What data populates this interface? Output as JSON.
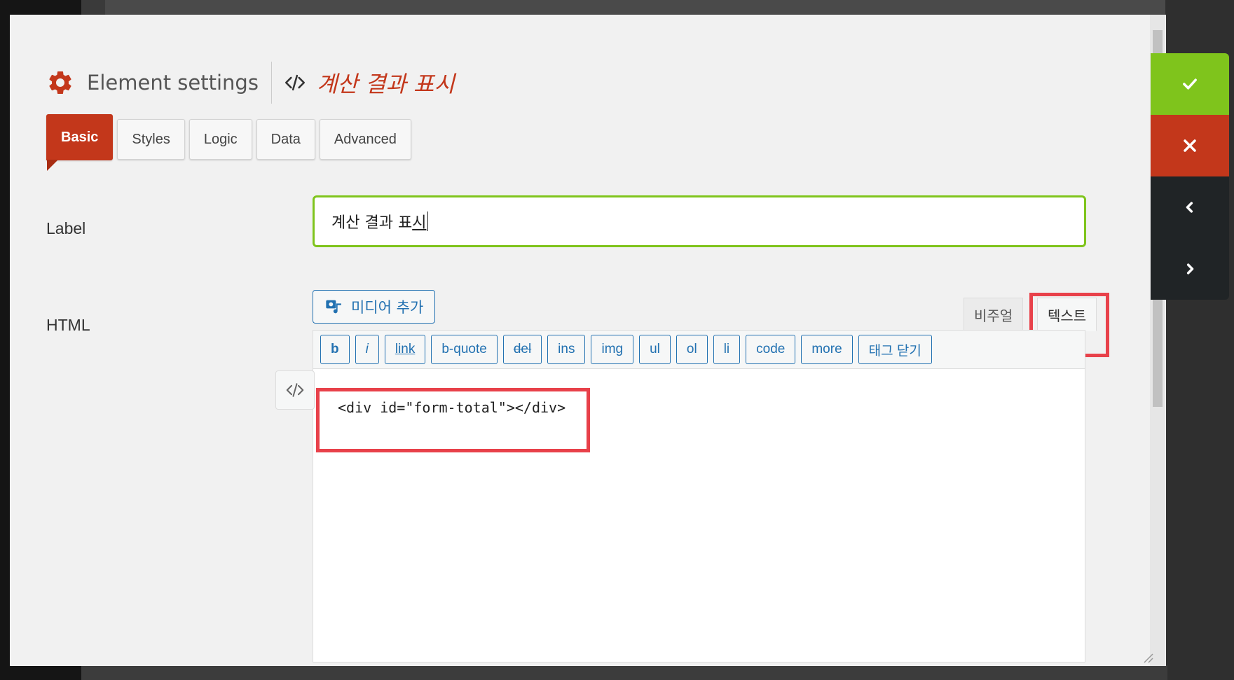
{
  "header": {
    "title": "Element settings",
    "element_name": "계산 결과 표시"
  },
  "tabs": [
    {
      "label": "Basic",
      "active": true
    },
    {
      "label": "Styles",
      "active": false
    },
    {
      "label": "Logic",
      "active": false
    },
    {
      "label": "Data",
      "active": false
    },
    {
      "label": "Advanced",
      "active": false
    }
  ],
  "fields": {
    "label_caption": "Label",
    "label_value_prefix": "계산 결과 표",
    "label_value_composing": "시",
    "html_caption": "HTML"
  },
  "editor": {
    "add_media_label": "미디어 추가",
    "mode_visual": "비주얼",
    "mode_text": "텍스트",
    "active_mode": "텍스트",
    "quicktags": [
      "b",
      "i",
      "link",
      "b-quote",
      "del",
      "ins",
      "img",
      "ul",
      "ol",
      "li",
      "code",
      "more",
      "태그 닫기"
    ],
    "content": "<div id=\"form-total\"></div>"
  },
  "actions": {
    "save_icon": "check-icon",
    "cancel_icon": "close-icon",
    "prev_icon": "chevron-left-icon",
    "next_icon": "chevron-right-icon"
  },
  "colors": {
    "accent_red": "#c3371b",
    "accent_green": "#7fc41c",
    "highlight": "#e8414a",
    "link_blue": "#2271b1"
  }
}
